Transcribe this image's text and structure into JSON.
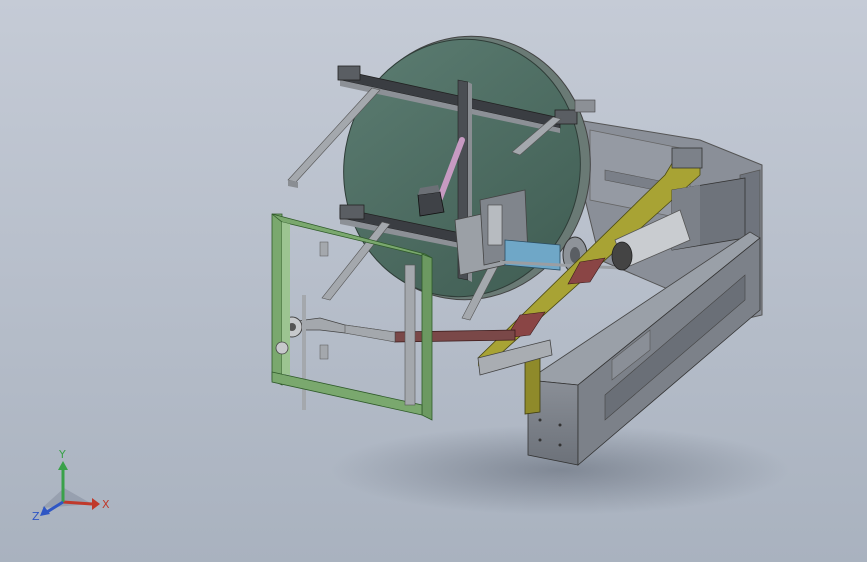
{
  "view": {
    "background_top": "#c5cbd6",
    "background_bottom": "#a9b2bf"
  },
  "model": {
    "parts": [
      "rotating-disc",
      "upper-beam-frame",
      "lower-beam-frame",
      "green-door-frame",
      "yellow-guide-rail",
      "base-housing",
      "motor-unit",
      "spindle-shaft",
      "linkage-arm"
    ],
    "colors": {
      "disc": "#4f6f64",
      "green_frame": "#7aa86e",
      "yellow_rail": "#a8a334",
      "red_block": "#8a4545",
      "housing": "#7c8189",
      "steel": "#9a9ea3",
      "blue_sleeve": "#6fa7c7",
      "pink_rod": "#c79ac2"
    }
  },
  "triad": {
    "x_label": "X",
    "y_label": "Y",
    "z_label": "Z",
    "x_color": "#c0392b",
    "y_color": "#3aa14a",
    "z_color": "#2f56c4"
  }
}
